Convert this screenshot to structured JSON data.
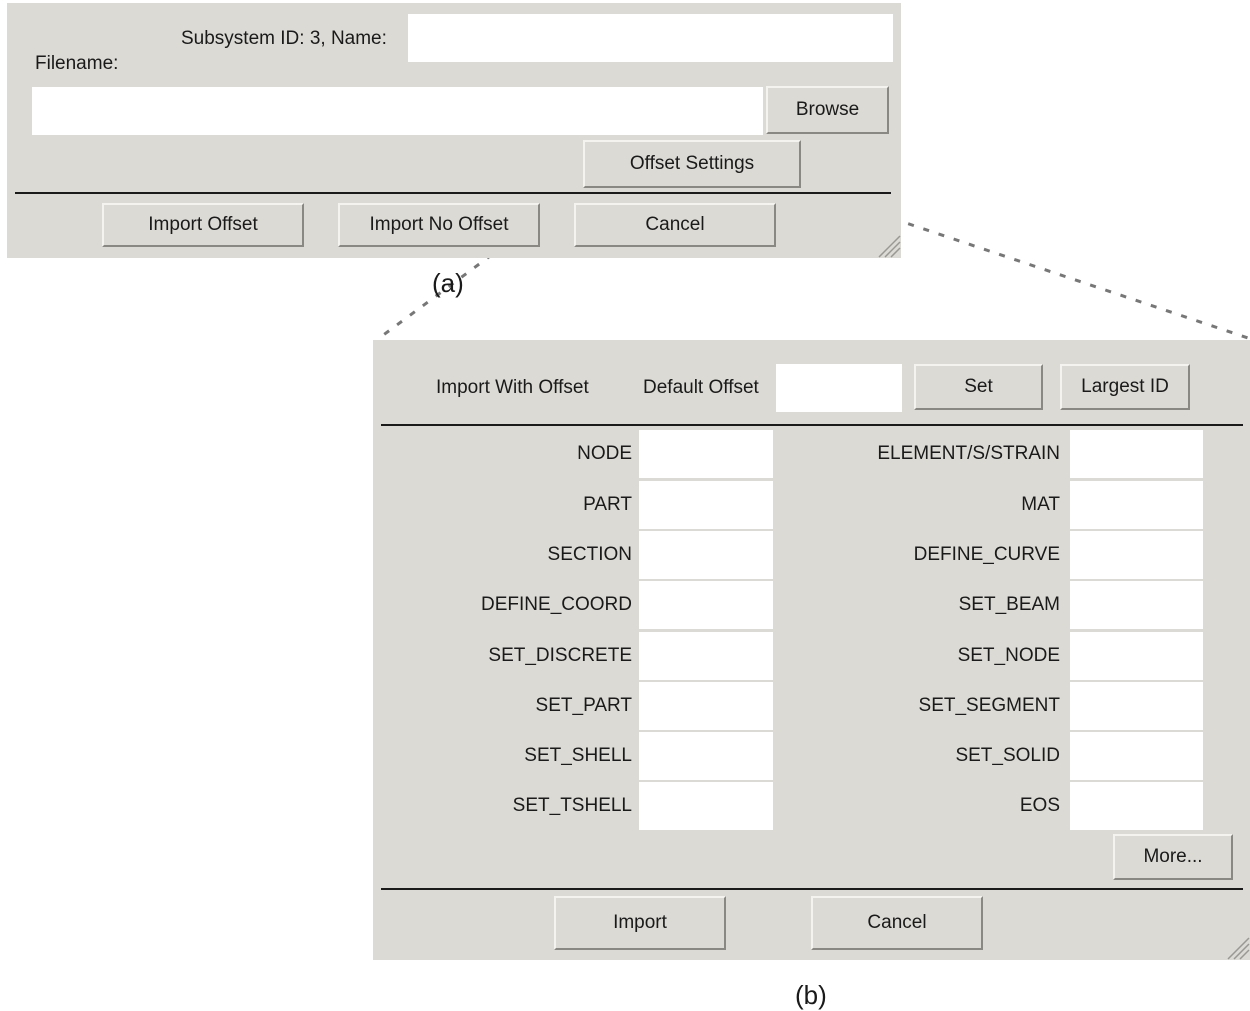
{
  "dialog_a": {
    "subsystem_label": "Subsystem ID: 3, Name:",
    "name_value": "",
    "filename_label": "Filename:",
    "filename_value": "",
    "browse_label": "Browse",
    "offset_settings_label": "Offset Settings",
    "import_offset_label": "Import Offset",
    "import_no_offset_label": "Import No Offset",
    "cancel_label": "Cancel",
    "caption": "(a)"
  },
  "dialog_b": {
    "import_with_offset_label": "Import With Offset",
    "default_offset_label": "Default Offset",
    "default_offset_value": "",
    "set_label": "Set",
    "largest_id_label": "Largest ID",
    "left_fields": [
      {
        "label": "NODE",
        "value": ""
      },
      {
        "label": "PART",
        "value": ""
      },
      {
        "label": "SECTION",
        "value": ""
      },
      {
        "label": "DEFINE_COORD",
        "value": ""
      },
      {
        "label": "SET_DISCRETE",
        "value": ""
      },
      {
        "label": "SET_PART",
        "value": ""
      },
      {
        "label": "SET_SHELL",
        "value": ""
      },
      {
        "label": "SET_TSHELL",
        "value": ""
      }
    ],
    "right_fields": [
      {
        "label": "ELEMENT/S/STRAIN",
        "value": ""
      },
      {
        "label": "MAT",
        "value": ""
      },
      {
        "label": "DEFINE_CURVE",
        "value": ""
      },
      {
        "label": "SET_BEAM",
        "value": ""
      },
      {
        "label": "SET_NODE",
        "value": ""
      },
      {
        "label": "SET_SEGMENT",
        "value": ""
      },
      {
        "label": "SET_SOLID",
        "value": ""
      },
      {
        "label": "EOS",
        "value": ""
      }
    ],
    "more_label": "More...",
    "import_label": "Import",
    "cancel_label": "Cancel",
    "caption": "(b)"
  }
}
